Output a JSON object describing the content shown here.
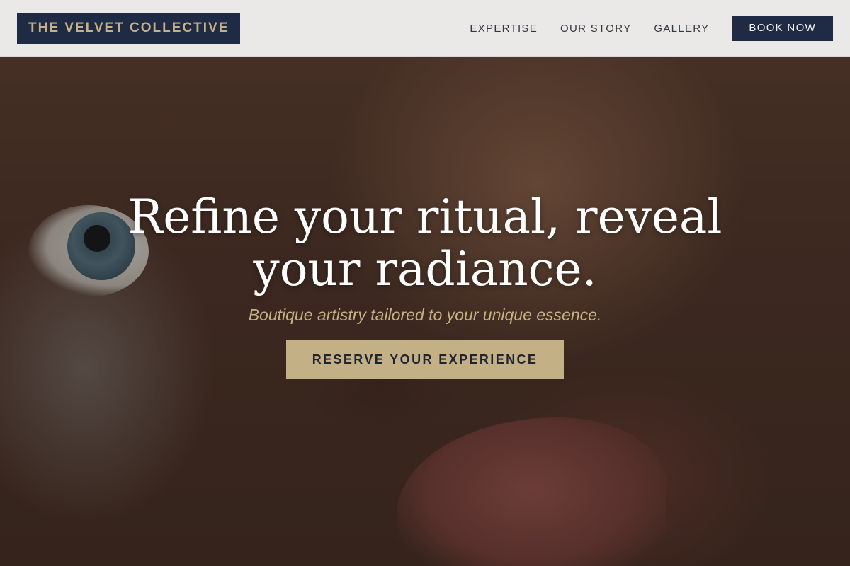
{
  "colors": {
    "navy": "#1f2a44",
    "gold": "#c3b085",
    "gold_text": "#c7b184",
    "header_bg": "#f0f0f0"
  },
  "header": {
    "logo": "THE VELVET COLLECTIVE",
    "nav": [
      {
        "label": "EXPERTISE"
      },
      {
        "label": "OUR STORY"
      },
      {
        "label": "GALLERY"
      }
    ],
    "book_label": "BOOK NOW"
  },
  "hero": {
    "title": "Refine your ritual, reveal your radiance.",
    "subtitle": "Boutique artistry tailored to your unique essence.",
    "cta_label": "RESERVE YOUR EXPERIENCE",
    "background": "portrait-closeup-image"
  }
}
